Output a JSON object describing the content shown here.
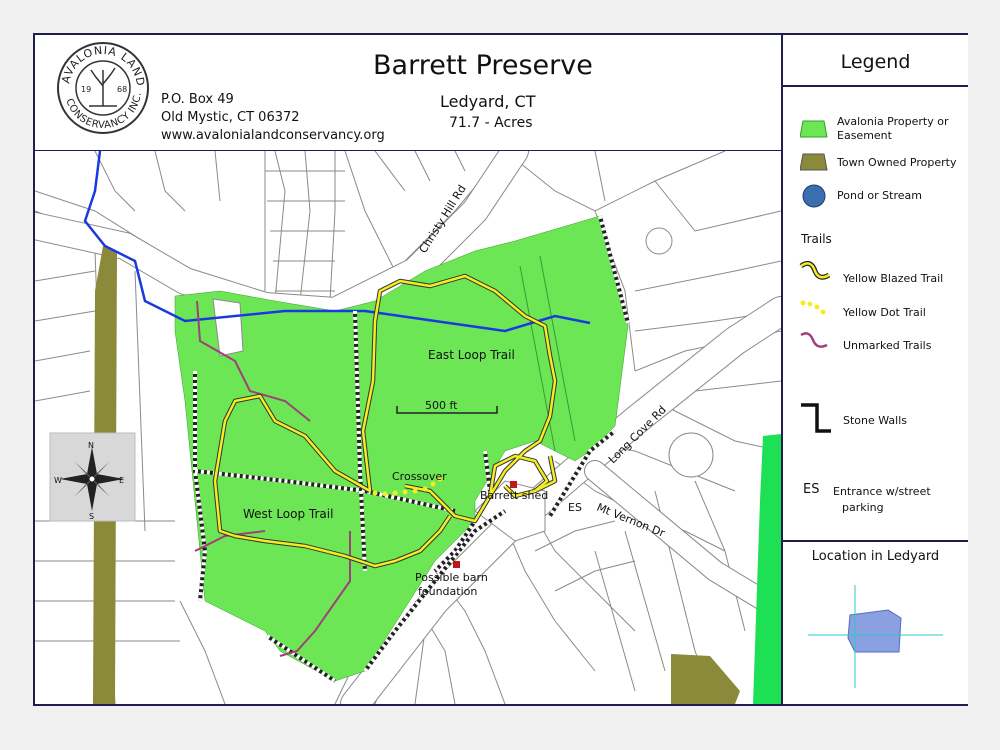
{
  "header": {
    "title": "Barrett Preserve",
    "town": "Ledyard, CT",
    "acres": "71.7 - Acres",
    "address_line1": "P.O. Box 49",
    "address_line2": "Old Mystic, CT 06372",
    "website": "www.avalonialandconservancy.org"
  },
  "logo": {
    "top_text": "AVALONIA LAND",
    "bottom_text": "CONSERVANCY INC.",
    "year_left": "19",
    "year_right": "68"
  },
  "legend": {
    "title": "Legend",
    "items": [
      {
        "label": "Avalonia Property or Easement",
        "color": "#6de655"
      },
      {
        "label": "Town Owned Property",
        "color": "#8a8a3a"
      },
      {
        "label": "Pond or Stream",
        "color": "#3a6fb0"
      }
    ],
    "trails_heading": "Trails",
    "trail_items": [
      {
        "label": "Yellow Blazed Trail",
        "color": "#e8e020"
      },
      {
        "label": "Yellow Dot Trail",
        "color": "#e8e020"
      },
      {
        "label": "Unmarked Trails",
        "color": "#a0407a"
      }
    ],
    "stone_walls": "Stone Walls",
    "es_code": "ES",
    "es_label_line1": "Entrance w/street",
    "es_label_line2": "parking",
    "location_title": "Location in Ledyard"
  },
  "map_labels": {
    "christy_hill": "Christy Hill Rd",
    "east_loop": "East Loop Trail",
    "west_loop": "West Loop Trail",
    "scale": "500 ft",
    "crossover": "Crossover",
    "barrett_shed": "Barrett shed",
    "long_cove": "Long Cove Rd",
    "es": "ES",
    "mt_vernon": "Mt Vernon Dr",
    "barn_line1": "Possible barn",
    "barn_line2": "foundation"
  },
  "compass": {
    "n": "N",
    "s": "S",
    "e": "E",
    "w": "W"
  }
}
